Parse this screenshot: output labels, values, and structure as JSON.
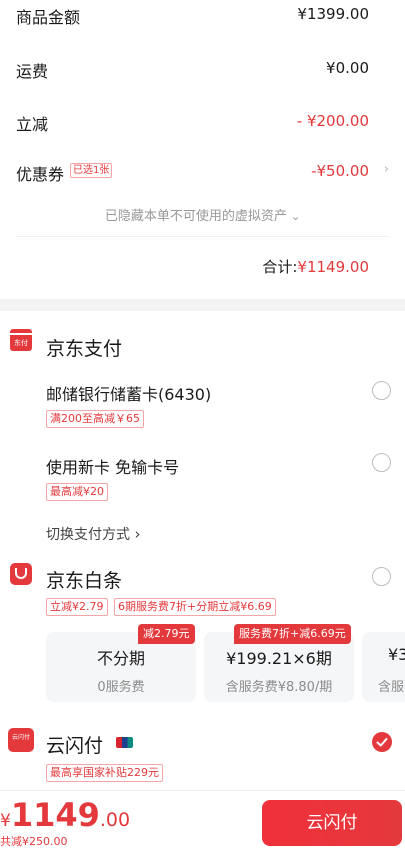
{
  "summary": {
    "goods_label": "商品金额",
    "goods_value": "¥1399.00",
    "shipping_label": "运费",
    "shipping_value": "¥0.00",
    "discount_label": "立减",
    "discount_value": "- ¥200.00",
    "coupon_label": "优惠券",
    "coupon_tag": "已选1张",
    "coupon_value": "-¥50.00",
    "hidden_note": "已隐藏本单不可使用的虚拟资产",
    "total_label": "合计:",
    "total_value": "¥1149.00"
  },
  "jd_pay": {
    "icon_text": "东付",
    "title": "京东支付",
    "bank_card": "邮储银行储蓄卡(6430)",
    "bank_card_tag": "满200至高减￥65",
    "new_card": "使用新卡 免输卡号",
    "new_card_tag": "最高减¥20",
    "switch_label": "切换支付方式"
  },
  "baitiao": {
    "title": "京东白条",
    "tag1": "立减¥2.79",
    "tag2": "6期服务费7折+分期立减¥6.69",
    "plans": [
      {
        "main": "不分期",
        "sub": "0服务费",
        "flag": "减2.79元"
      },
      {
        "main": "¥199.21×6期",
        "sub": "含服务费¥8.80/期",
        "flag": "服务费7折+减6.69元"
      },
      {
        "main": "¥3",
        "sub": "含服"
      }
    ]
  },
  "unionpay": {
    "icon_text": "云闪付",
    "title": "云闪付",
    "tag": "最高享国家补贴229元"
  },
  "footer": {
    "currency": "¥",
    "amount_int": "1149",
    "amount_dec": ".00",
    "saved": "共减¥250.00",
    "button": "云闪付"
  },
  "colors": {
    "accent": "#e4393c",
    "background": "#ffffff",
    "card": "#f5f6f8"
  },
  "icons": [
    "chevron-right-icon",
    "chevron-down-icon",
    "jd-pay-icon",
    "baitiao-icon",
    "unionpay-icon",
    "union-card-icon",
    "check-icon"
  ]
}
